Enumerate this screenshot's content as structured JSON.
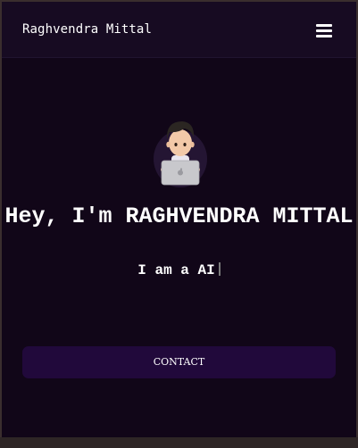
{
  "navbar": {
    "brand": "Raghvendra Mittal",
    "menu_icon": "hamburger-menu-icon"
  },
  "hero": {
    "avatar_icon": "memoji-laptop-avatar",
    "title": "Hey, I'm RAGHVENDRA MITTAL",
    "subtitle": "I am a AI"
  },
  "contact_button": {
    "label": "CONTACT"
  },
  "colors": {
    "page_background": "#110618",
    "navbar_background": "#170b22",
    "button_background": "#21093b",
    "text": "#ffffff"
  }
}
